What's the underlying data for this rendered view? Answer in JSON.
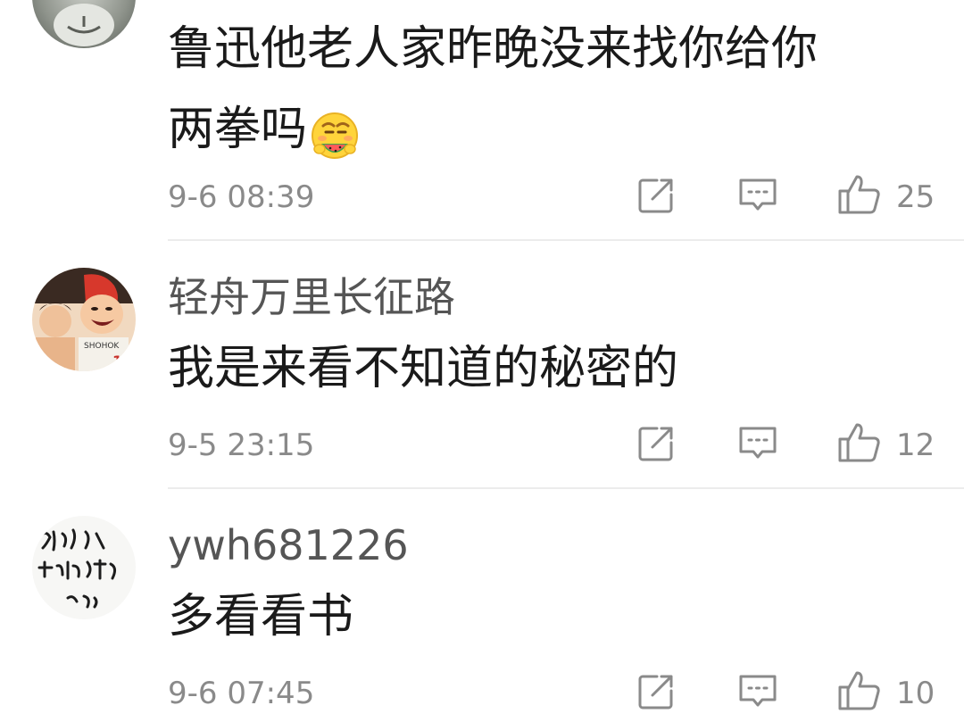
{
  "comments": [
    {
      "username": "",
      "text_line1": "鲁迅他老人家昨晚没来找你给你",
      "text_line2": "两拳吗",
      "emoji": "eating-watermelon-emoji",
      "timestamp": "9-6 08:39",
      "likes": "25"
    },
    {
      "username": "轻舟万里长征路",
      "text_line1": "我是来看不知道的秘密的",
      "timestamp": "9-5 23:15",
      "likes": "12"
    },
    {
      "username": "ywh681226",
      "text_line1": "多看看书",
      "timestamp": "9-6 07:45",
      "likes": "10"
    }
  ],
  "icons": {
    "share": "share-icon",
    "reply": "reply-icon",
    "like": "thumbs-up-icon"
  },
  "colors": {
    "text_primary": "#1a1a1a",
    "text_secondary": "#555555",
    "text_muted": "#8a8a8a",
    "divider": "#ececec"
  }
}
